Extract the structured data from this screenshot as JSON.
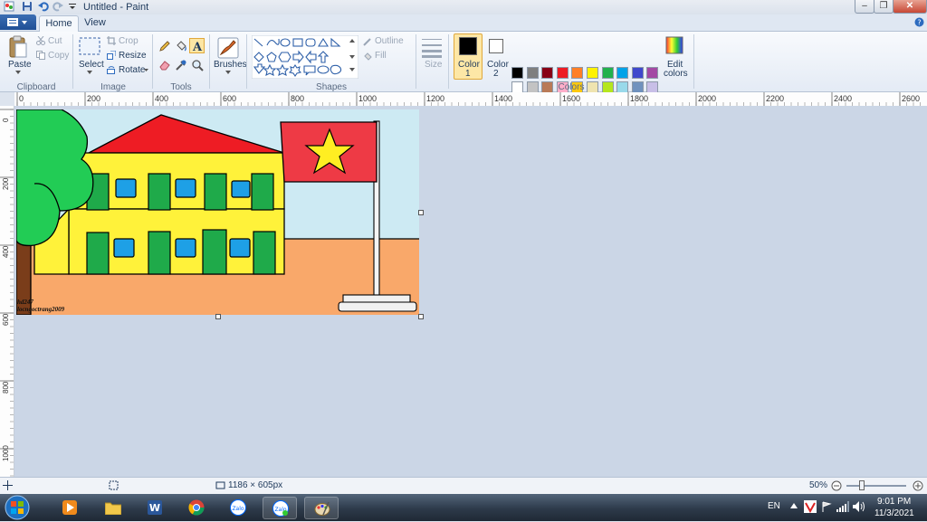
{
  "window": {
    "title": "Untitled - Paint"
  },
  "tabs": [
    {
      "label": "Home"
    },
    {
      "label": "View"
    }
  ],
  "ribbon": {
    "clipboard": {
      "group": "Clipboard",
      "paste": "Paste",
      "cut": "Cut",
      "copy": "Copy"
    },
    "image": {
      "group": "Image",
      "select": "Select",
      "crop": "Crop",
      "resize": "Resize",
      "rotate": "Rotate"
    },
    "tools": {
      "group": "Tools"
    },
    "brushes": {
      "label": "Brushes"
    },
    "shapes": {
      "group": "Shapes",
      "outline": "Outline",
      "fill": "Fill"
    },
    "size": {
      "label": "Size"
    },
    "colors": {
      "group": "Colors",
      "color1": "Color",
      "color1_num": "1",
      "color2": "Color",
      "color2_num": "2",
      "edit": "Edit",
      "edit2": "colors",
      "color1_value": "#000000",
      "color2_value": "#ffffff",
      "palette_row1": [
        "#000000",
        "#7f7f7f",
        "#880015",
        "#ed1c24",
        "#ff7f27",
        "#fff200",
        "#22b14c",
        "#00a2e8",
        "#3f48cc",
        "#a349a4"
      ],
      "palette_row2": [
        "#ffffff",
        "#c3c3c3",
        "#b97a57",
        "#ffaec9",
        "#ffc90e",
        "#efe4b0",
        "#b5e61d",
        "#99d9ea",
        "#7092be",
        "#c8bfe7"
      ],
      "palette_row3": [
        "#fff6a8",
        "#8ee6a0",
        "#ee4444",
        "#e8e8e8",
        "#22b14c",
        "#fff200",
        "#dbe6f0",
        "#7ad06b",
        "#ffa060",
        "#dbe6f0"
      ]
    }
  },
  "ruler": {
    "h": [
      "0",
      "200",
      "400",
      "600",
      "800",
      "1000",
      "1200",
      "1400",
      "1600",
      "1800",
      "2000",
      "2200",
      "2400",
      "2600"
    ],
    "v": [
      "0",
      "200",
      "400",
      "600",
      "800",
      "1000"
    ]
  },
  "drawing": {
    "signature1": "hd247",
    "signature2": "locngoctrang2009",
    "colors": {
      "sky": "#cdeaf3",
      "ground": "#f9a86a",
      "roof": "#ee1c24",
      "wall": "#fff23a",
      "door": "#1faa4a",
      "window": "#1ea0e6",
      "tree": "#22cc55",
      "flag": "#ee3a45",
      "star": "#ffee22"
    }
  },
  "status": {
    "size": "1186 × 605px",
    "zoom": "50%"
  },
  "taskbar": {
    "lang": "EN",
    "time": "9:01 PM",
    "date": "11/3/2021"
  }
}
